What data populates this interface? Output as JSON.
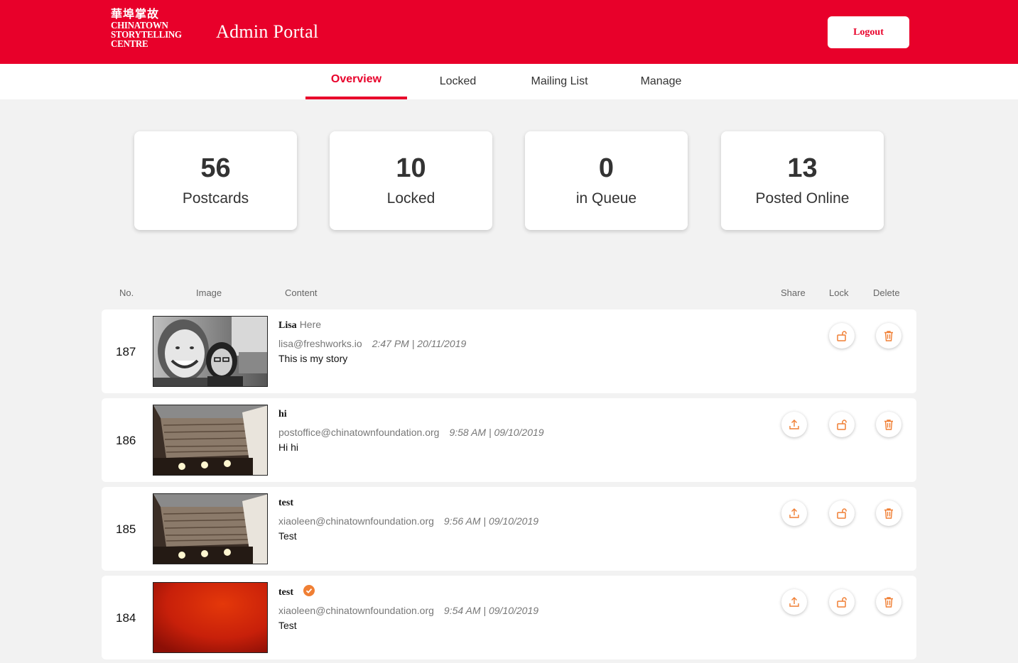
{
  "header": {
    "logo_cn": "華埠掌故",
    "logo_lines": [
      "CHINATOWN",
      "STORYTELLING",
      "CENTRE"
    ],
    "title": "Admin Portal",
    "logout_label": "Logout"
  },
  "tabs": [
    {
      "label": "Overview",
      "active": true
    },
    {
      "label": "Locked",
      "active": false
    },
    {
      "label": "Mailing List",
      "active": false
    },
    {
      "label": "Manage",
      "active": false
    }
  ],
  "stats": [
    {
      "value": "56",
      "label": "Postcards"
    },
    {
      "value": "10",
      "label": "Locked"
    },
    {
      "value": "0",
      "label": "in Queue"
    },
    {
      "value": "13",
      "label": "Posted Online"
    }
  ],
  "table": {
    "columns": [
      "No.",
      "Image",
      "Content",
      "Share",
      "Lock",
      "Delete"
    ],
    "rows": [
      {
        "no": "187",
        "first": "Lisa",
        "last": "Here",
        "email": "lisa@freshworks.io",
        "date": "2:47 PM | 20/11/2019",
        "body": "This is my story",
        "image": "selfie-photo",
        "share_visible": false,
        "verified": false
      },
      {
        "no": "186",
        "first": "hi",
        "last": "",
        "email": "postoffice@chinatownfoundation.org",
        "date": "9:58 AM | 09/10/2019",
        "body": "Hi hi",
        "image": "wood-ceiling-photo",
        "share_visible": true,
        "verified": false
      },
      {
        "no": "185",
        "first": "test",
        "last": "",
        "email": "xiaoleen@chinatownfoundation.org",
        "date": "9:56 AM | 09/10/2019",
        "body": "Test",
        "image": "wood-ceiling-photo",
        "share_visible": true,
        "verified": false
      },
      {
        "no": "184",
        "first": "test",
        "last": "",
        "email": "xiaoleen@chinatownfoundation.org",
        "date": "9:54 AM | 09/10/2019",
        "body": "Test",
        "image": "red-gradient-photo",
        "share_visible": true,
        "verified": true
      }
    ]
  },
  "colors": {
    "brand": "#e8002a",
    "action": "#f07f34"
  },
  "icons": {
    "share": "share-upload-icon",
    "lock": "unlock-icon",
    "delete": "trash-icon",
    "verified": "check-circle-icon"
  }
}
